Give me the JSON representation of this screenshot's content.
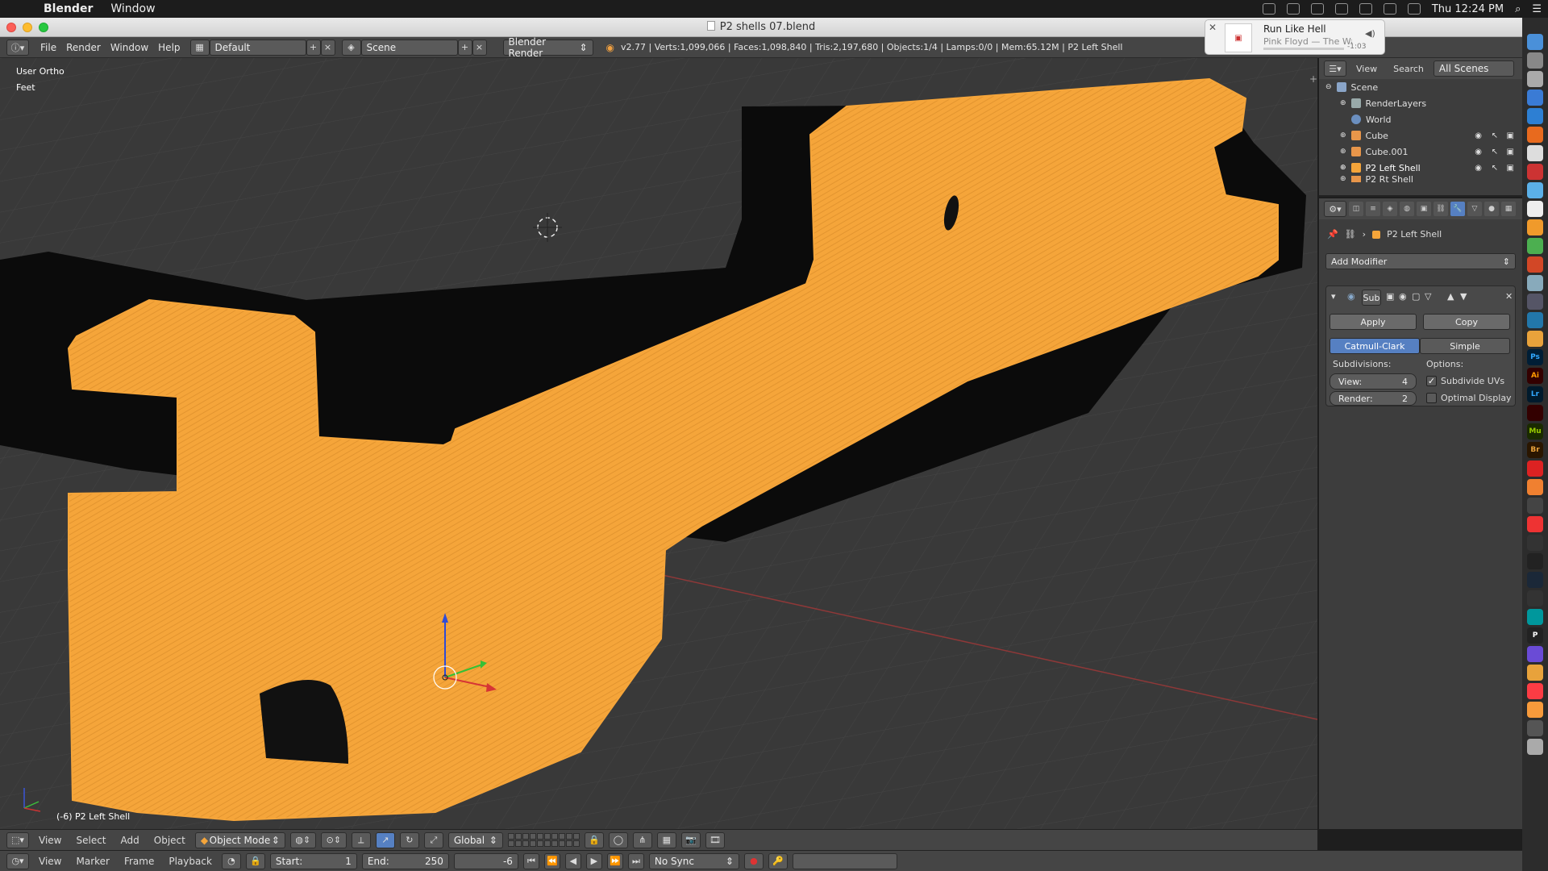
{
  "menubar": {
    "app": "Blender",
    "items": [
      "Window"
    ],
    "clock": "Thu 12:24 PM"
  },
  "window": {
    "title": "P2 shells 07.blend"
  },
  "info_header": {
    "menus": [
      "File",
      "Render",
      "Window",
      "Help"
    ],
    "layout": "Default",
    "scene": "Scene",
    "engine": "Blender Render",
    "stats": "v2.77 | Verts:1,099,066 | Faces:1,098,840 | Tris:2,197,680 | Objects:1/4 | Lamps:0/0 | Mem:65.12M | P2 Left Shell"
  },
  "now_playing": {
    "title": "Run Like Hell",
    "artist": "Pink Floyd — The Wa...",
    "time": "-1:03",
    "progress": 0.65
  },
  "viewport": {
    "view_name": "User Ortho",
    "units": "Feet",
    "object_label": "(-6) P2 Left Shell",
    "colors": {
      "background": "#393939",
      "selected_mesh": "#f5a53a",
      "x_axis": "#9c3a3a"
    }
  },
  "outliner": {
    "tabs": [
      "View",
      "Search",
      "All Scenes"
    ],
    "rows": [
      {
        "label": "Scene",
        "icon": "scene-icon"
      },
      {
        "label": "RenderLayers",
        "icon": "render-layers-icon"
      },
      {
        "label": "World",
        "icon": "world-icon"
      },
      {
        "label": "Cube",
        "icon": "mesh-icon"
      },
      {
        "label": "Cube.001",
        "icon": "mesh-icon"
      },
      {
        "label": "P2 Left Shell",
        "icon": "mesh-icon"
      },
      {
        "label": "P2 Rt Shell",
        "icon": "mesh-icon"
      }
    ]
  },
  "properties": {
    "breadcrumb": "P2 Left Shell",
    "add_modifier": "Add Modifier",
    "modifier": {
      "name": "Sub",
      "apply": "Apply",
      "copy": "Copy",
      "mode_catmull": "Catmull-Clark",
      "mode_simple": "Simple",
      "subdivisions_label": "Subdivisions:",
      "options_label": "Options:",
      "view_label": "View:",
      "view_value": "4",
      "render_label": "Render:",
      "render_value": "2",
      "subdivide_uvs": "Subdivide UVs",
      "optimal_display": "Optimal Display"
    }
  },
  "view3d_header": {
    "menus": [
      "View",
      "Select",
      "Add",
      "Object"
    ],
    "mode": "Object Mode",
    "orientation": "Global"
  },
  "timeline_header": {
    "menus": [
      "View",
      "Marker",
      "Frame",
      "Playback"
    ],
    "start_label": "Start:",
    "start": "1",
    "end_label": "End:",
    "end": "250",
    "current": "-6",
    "sync": "No Sync"
  },
  "dock_icons": [
    "Ps",
    "Ai",
    "Lr",
    "Mu",
    "Br",
    "P"
  ]
}
